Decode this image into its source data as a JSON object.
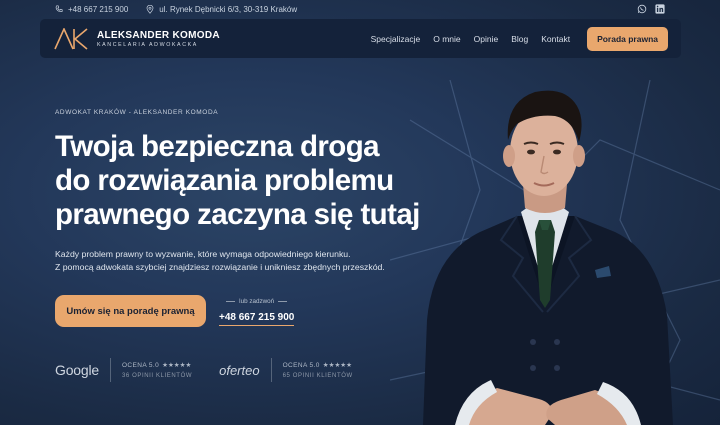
{
  "topbar": {
    "phone": "+48 667 215 900",
    "address": "ul. Rynek Dębnicki 6/3, 30-319 Kraków",
    "social": [
      "whatsapp-icon",
      "linkedin-icon"
    ]
  },
  "brand": {
    "name": "ALEKSANDER KOMODA",
    "subtitle": "KANCELARIA ADWOKACKA"
  },
  "nav": {
    "items": [
      "Specjalizacje",
      "O mnie",
      "Opinie",
      "Blog",
      "Kontakt"
    ],
    "cta": "Porada prawna"
  },
  "hero": {
    "eyebrow": "ADWOKAT KRAKÓW - ALEKSANDER KOMODA",
    "headline": [
      "Twoja bezpieczna droga",
      "do rozwiązania problemu",
      "prawnego zaczyna się tutaj"
    ],
    "description": [
      "Każdy problem prawny to wyzwanie, które wymaga odpowiedniego kierunku.",
      "Z pomocą adwokata szybciej znajdziesz rozwiązanie i unikniesz zbędnych przeszkód."
    ],
    "cta": "Umów się na poradę prawną",
    "call_label": "lub zadzwoń",
    "call_phone": "+48 667 215 900"
  },
  "ratings": [
    {
      "brand": "Google",
      "score": "OCENA 5.0",
      "stars": "★★★★★",
      "count": "36 OPINII KLIENTÓW"
    },
    {
      "brand": "oferteo",
      "score": "OCENA 5.0",
      "stars": "★★★★★",
      "count": "65 OPINII KLIENTÓW"
    }
  ],
  "colors": {
    "accent": "#e9a76d",
    "background": "#1f3149",
    "nav_background": "#14223a"
  }
}
